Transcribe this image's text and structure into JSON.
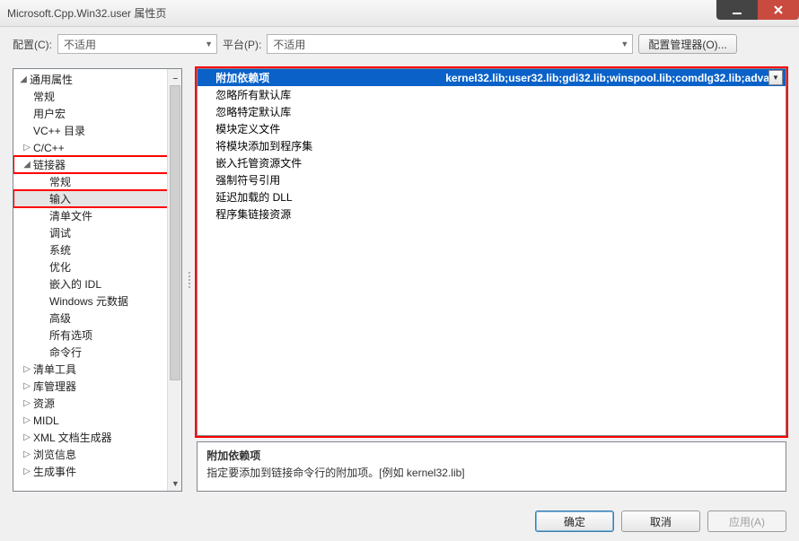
{
  "window": {
    "title": "Microsoft.Cpp.Win32.user 属性页"
  },
  "toolbar": {
    "config_label": "配置(C):",
    "config_value": "不适用",
    "platform_label": "平台(P):",
    "platform_value": "不适用",
    "config_mgr": "配置管理器(O)..."
  },
  "tree": {
    "root": "通用属性",
    "items_top": [
      "常规",
      "用户宏",
      "VC++ 目录"
    ],
    "c_cpp": "C/C++",
    "linker": "链接器",
    "linker_items": [
      "常规",
      "输入",
      "清单文件",
      "调试",
      "系统",
      "优化",
      "嵌入的 IDL",
      "Windows 元数据",
      "高级",
      "所有选项",
      "命令行"
    ],
    "rest": [
      "清单工具",
      "库管理器",
      "资源",
      "MIDL",
      "XML 文档生成器",
      "浏览信息",
      "生成事件"
    ]
  },
  "props": {
    "rows": [
      {
        "label": "附加依赖项",
        "value": "kernel32.lib;user32.lib;gdi32.lib;winspool.lib;comdlg32.lib;adva"
      },
      {
        "label": "忽略所有默认库",
        "value": ""
      },
      {
        "label": "忽略特定默认库",
        "value": ""
      },
      {
        "label": "模块定义文件",
        "value": ""
      },
      {
        "label": "将模块添加到程序集",
        "value": ""
      },
      {
        "label": "嵌入托管资源文件",
        "value": ""
      },
      {
        "label": "强制符号引用",
        "value": ""
      },
      {
        "label": "延迟加载的 DLL",
        "value": ""
      },
      {
        "label": "程序集链接资源",
        "value": ""
      }
    ]
  },
  "desc": {
    "title": "附加依赖项",
    "body": "指定要添加到链接命令行的附加项。[例如 kernel32.lib]"
  },
  "buttons": {
    "ok": "确定",
    "cancel": "取消",
    "apply": "应用(A)"
  }
}
